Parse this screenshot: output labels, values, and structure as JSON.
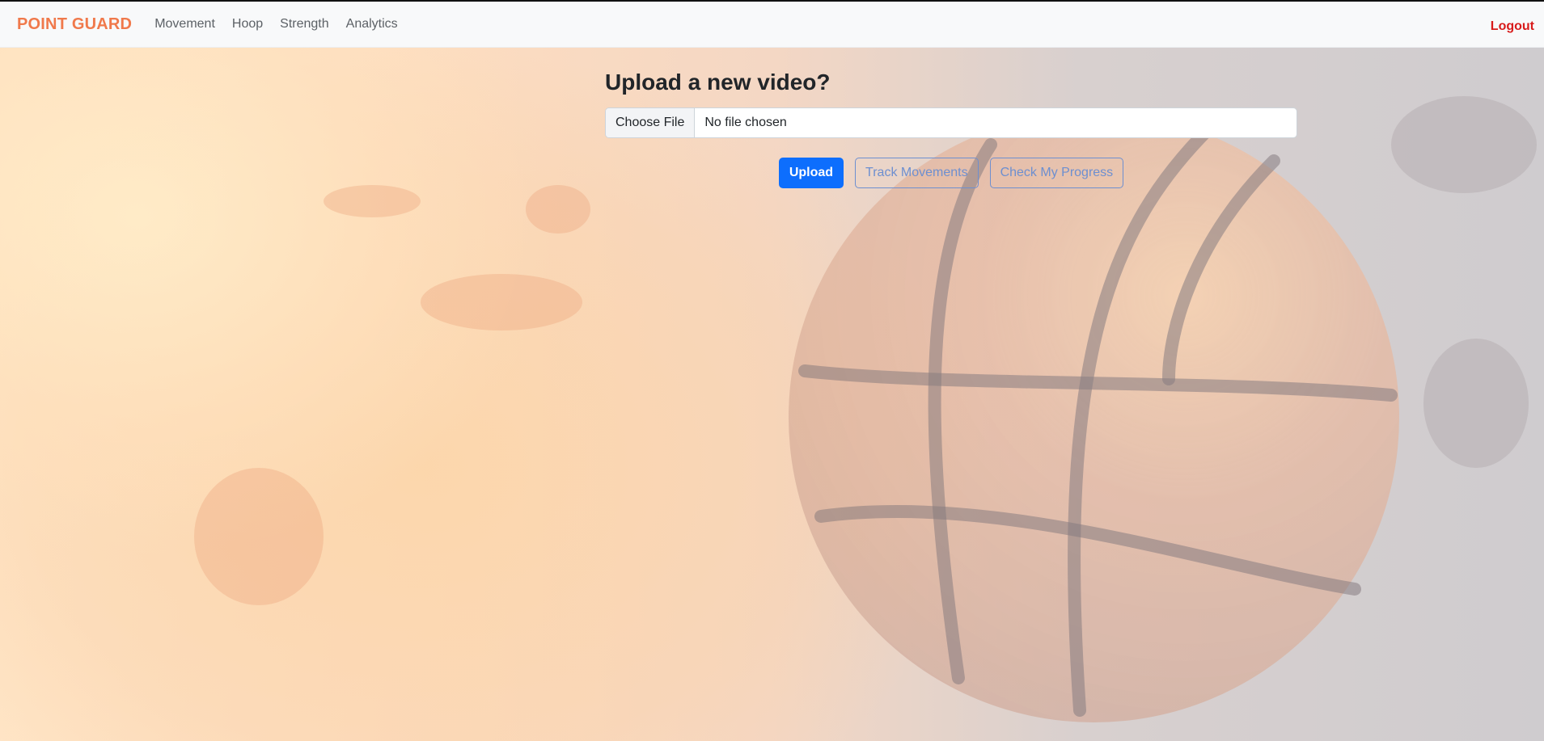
{
  "navbar": {
    "brand": "POINT GUARD",
    "links": [
      "Movement",
      "Hoop",
      "Strength",
      "Analytics"
    ],
    "logout": "Logout"
  },
  "upload": {
    "title": "Upload a new video?",
    "choose_file": "Choose File",
    "file_status": "No file chosen"
  },
  "actions": {
    "upload": "Upload",
    "track": "Track Movements",
    "progress": "Check My Progress"
  },
  "colors": {
    "brand": "#f0794b",
    "primary": "#0d6efd",
    "logout": "#d81b1b"
  }
}
